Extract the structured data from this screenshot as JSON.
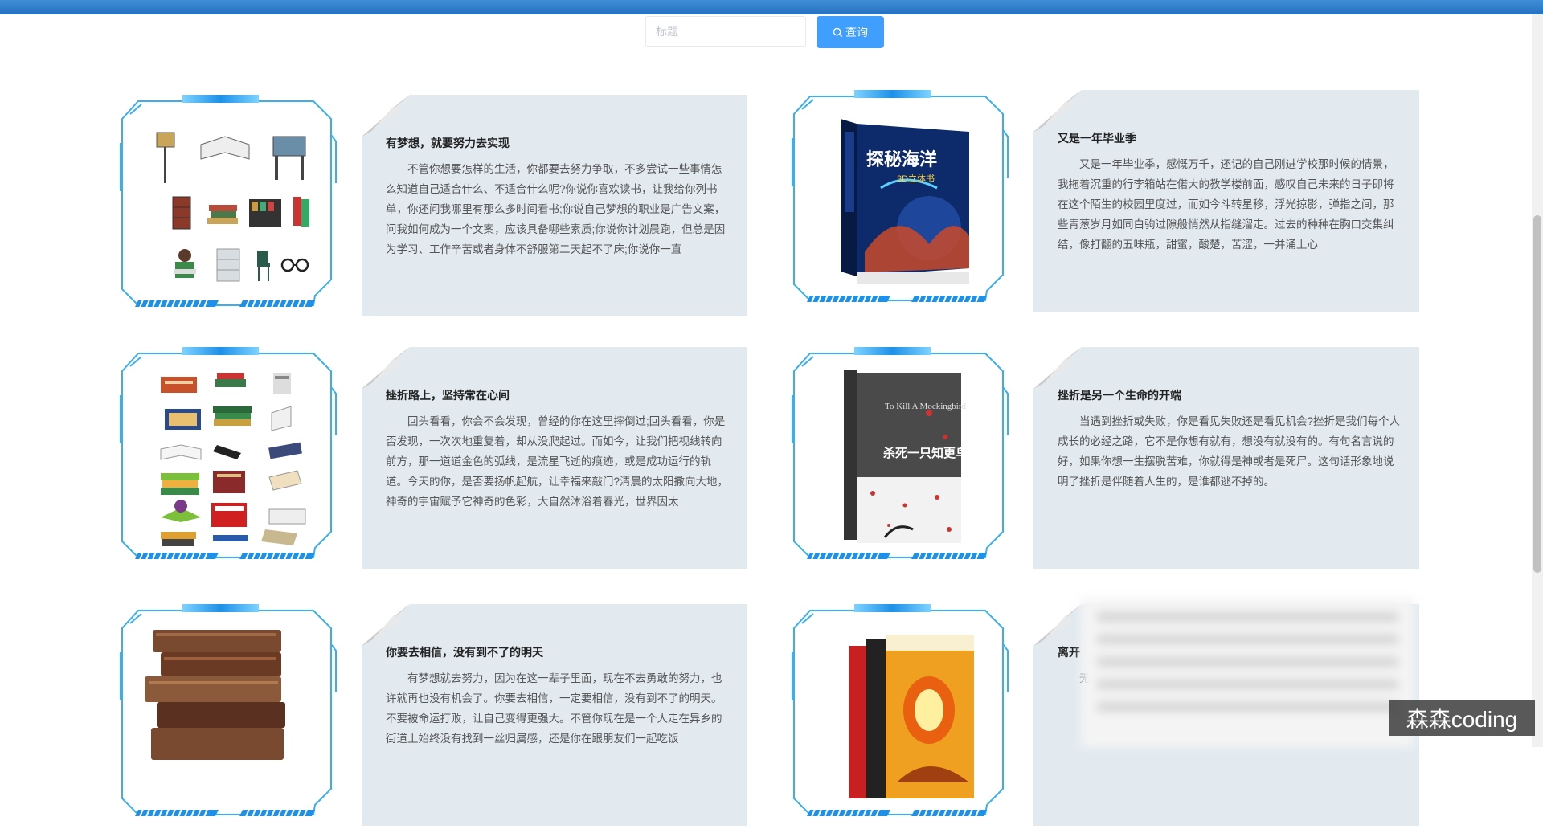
{
  "search": {
    "placeholder": "标题",
    "button_label": "查询"
  },
  "articles": [
    {
      "title": "有梦想，就要努力去实现",
      "body": "不管你想要怎样的生活，你都要去努力争取，不多尝试一些事情怎么知道自己适合什么、不适合什么呢?你说你喜欢读书，让我给你列书单，你还问我哪里有那么多时间看书;你说自己梦想的职业是广告文案，问我如何成为一个文案，应该具备哪些素质;你说你计划晨跑，但总是因为学习、工作辛苦或者身体不舒服第二天起不了床;你说你一直",
      "image": "library-icons"
    },
    {
      "title": "又是一年毕业季",
      "body": "又是一年毕业季，感慨万千，还记的自己刚进学校那时候的情景，我拖着沉重的行李箱站在偌大的教学楼前面，感叹自己未来的日子即将在这个陌生的校园里度过，而如今斗转星移，浮光掠影，弹指之间，那些青葱岁月如同白驹过隙般悄然从指缝溜走。过去的种种在胸口交集纠结，像打翻的五味瓶，甜蜜，酸楚，苦涩，一并涌上心",
      "image": "book-cover-ocean",
      "cover_title": "探秘海洋",
      "cover_subtitle": "3D立体书"
    },
    {
      "title": "挫折路上，坚持常在心间",
      "body": "回头看看，你会不会发现，曾经的你在这里摔倒过;回头看看，你是否发现，一次次地重复着，却从没爬起过。而如今，让我们把视线转向前方，那一道道金色的弧线，是流星飞逝的痕迹，或是成功运行的轨道。今天的你，是否要扬帆起航，让幸福来敲门?清晨的太阳撒向大地，神奇的宇宙赋予它神奇的色彩，大自然沐浴着春光，世界因太",
      "image": "stack-of-books-icons"
    },
    {
      "title": "挫折是另一个生命的开端",
      "body": "当遇到挫折或失败，你是看见失败还是看见机会?挫折是我们每个人成长的必经之路，它不是你想有就有，想没有就没有的。有句名言说的好，如果你想一生摆脱苦难，你就得是神或者是死尸。这句话形象地说明了挫折是伴随着人生的，是谁都逃不掉的。",
      "image": "book-cover-mockingbird",
      "cover_title": "To Kill A Mockingbird",
      "cover_subtitle": "杀死一只知更鸟"
    },
    {
      "title": "你要去相信，没有到不了的明天",
      "body": "有梦想就去努力，因为在这一辈子里面，现在不去勇敢的努力，也许就再也没有机会了。你要去相信，一定要相信，没有到不了的明天。不要被命运打败，让自己变得更强大。不管你现在是一个人走在异乡的街道上始终没有找到一丝归属感，还是你在跟朋友们一起吃饭",
      "image": "old-books-stack"
    },
    {
      "title": "离开",
      "body": "无相濡以友谊之同想自",
      "image": "book-cover-scifi"
    }
  ],
  "watermark": "森森coding",
  "colors": {
    "accent": "#409eff",
    "topbar": "#2c7ac6",
    "panel": "#e2eaf0",
    "frame": "#2aa8f0"
  }
}
